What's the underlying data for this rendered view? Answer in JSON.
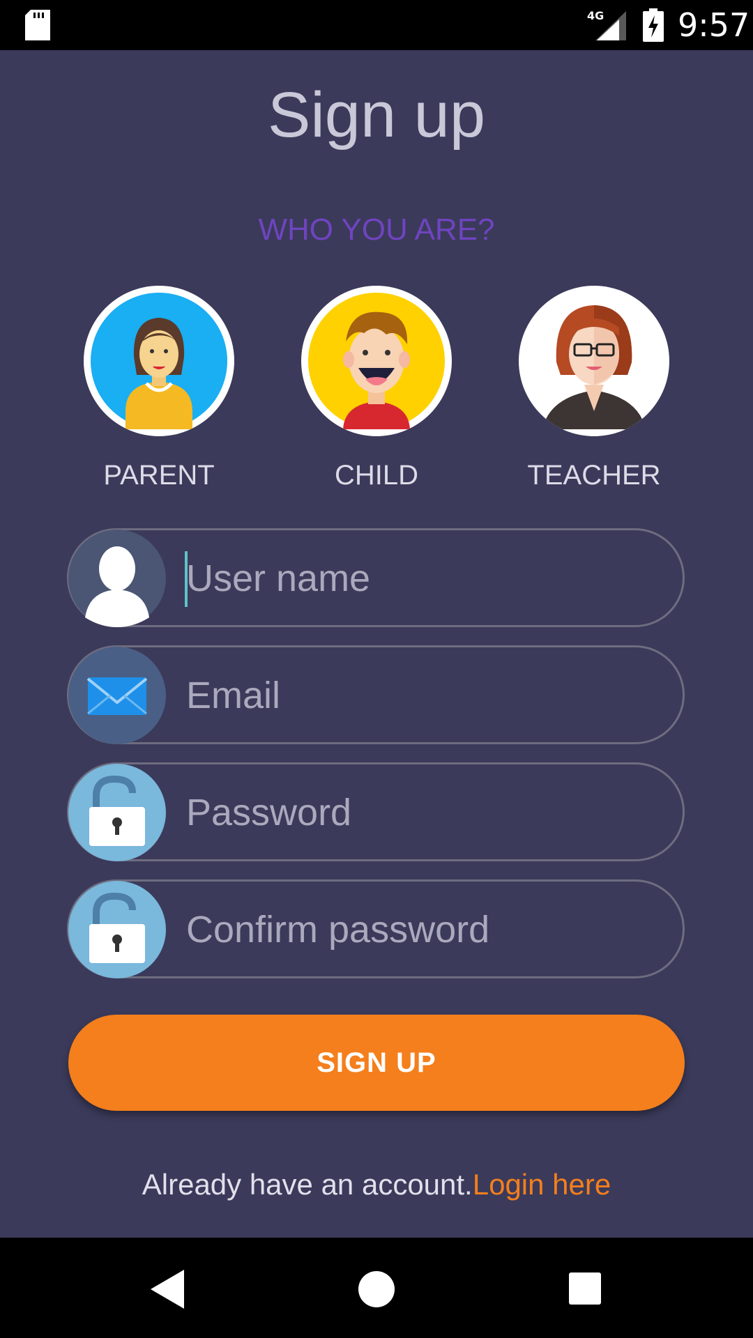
{
  "status_bar": {
    "time": "9:57",
    "network": "4G"
  },
  "title": "Sign up",
  "who_label": "WHO YOU ARE?",
  "roles": [
    {
      "label": "PARENT",
      "icon": "parent-avatar",
      "bg": "#1aaef2"
    },
    {
      "label": "CHILD",
      "icon": "child-avatar",
      "bg": "#ffd100"
    },
    {
      "label": "TEACHER",
      "icon": "teacher-avatar",
      "bg": "#ffffff"
    }
  ],
  "fields": {
    "username": {
      "placeholder": "User name",
      "value": "",
      "icon": "user-icon"
    },
    "email": {
      "placeholder": "Email",
      "value": "",
      "icon": "envelope-icon"
    },
    "password": {
      "placeholder": "Password",
      "value": "",
      "icon": "unlock-icon"
    },
    "confirm_password": {
      "placeholder": "Confirm password",
      "value": "",
      "icon": "unlock-icon"
    }
  },
  "signup_button": "SIGN UP",
  "footer": {
    "text": "Already have an account.",
    "link": "Login here"
  },
  "colors": {
    "background": "#3b3a5a",
    "accent": "#f47f1c",
    "purple": "#6f44c0"
  }
}
